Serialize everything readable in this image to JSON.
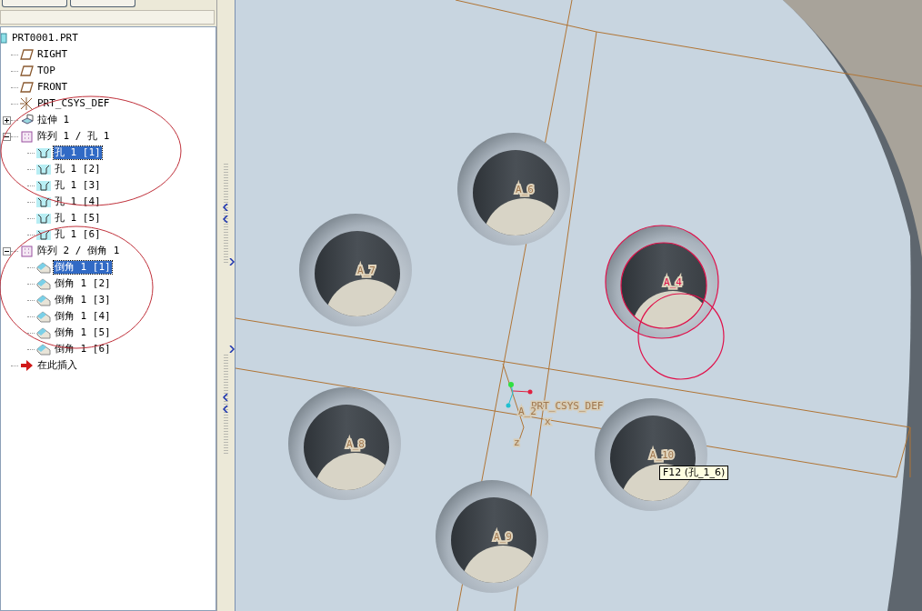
{
  "model_tree": {
    "root": {
      "label": "PRT0001.PRT",
      "kind": "part",
      "children": [
        {
          "label": "RIGHT",
          "kind": "plane",
          "selected": false
        },
        {
          "label": "TOP",
          "kind": "plane",
          "selected": false
        },
        {
          "label": "FRONT",
          "kind": "plane",
          "selected": false
        },
        {
          "label": "PRT_CSYS_DEF",
          "kind": "csys",
          "selected": false
        },
        {
          "label": "拉伸 1",
          "kind": "extrude",
          "selected": false,
          "expanded": false
        },
        {
          "label": "阵列 1 / 孔 1",
          "kind": "pattern",
          "selected": false,
          "expanded": true,
          "children": [
            {
              "label": "孔 1 [1]",
              "kind": "hole",
              "selected": true
            },
            {
              "label": "孔 1 [2]",
              "kind": "hole",
              "selected": false
            },
            {
              "label": "孔 1 [3]",
              "kind": "hole",
              "selected": false
            },
            {
              "label": "孔 1 [4]",
              "kind": "hole",
              "selected": false
            },
            {
              "label": "孔 1 [5]",
              "kind": "hole",
              "selected": false
            },
            {
              "label": "孔 1 [6]",
              "kind": "hole",
              "selected": false
            }
          ]
        },
        {
          "label": "阵列 2 / 倒角 1",
          "kind": "pattern",
          "selected": false,
          "expanded": true,
          "children": [
            {
              "label": "倒角 1 [1]",
              "kind": "chamfer",
              "selected": true
            },
            {
              "label": "倒角 1 [2]",
              "kind": "chamfer",
              "selected": false
            },
            {
              "label": "倒角 1 [3]",
              "kind": "chamfer",
              "selected": false
            },
            {
              "label": "倒角 1 [4]",
              "kind": "chamfer",
              "selected": false
            },
            {
              "label": "倒角 1 [5]",
              "kind": "chamfer",
              "selected": false
            },
            {
              "label": "倒角 1 [6]",
              "kind": "chamfer",
              "selected": false
            }
          ]
        },
        {
          "label": "在此插入",
          "kind": "insert",
          "selected": false
        }
      ]
    }
  },
  "viewport": {
    "holes": [
      {
        "label": "A_6",
        "highlighted": false
      },
      {
        "label": "A_7",
        "highlighted": false
      },
      {
        "label": "A_4",
        "highlighted": true
      },
      {
        "label": "A_8",
        "highlighted": false
      },
      {
        "label": "A_9",
        "highlighted": false
      },
      {
        "label": "A_10",
        "highlighted": false
      }
    ],
    "csys": {
      "label": "PRT_CSYS_DEF",
      "axis_label": "A_2",
      "x_label": "x",
      "z_label": "z"
    },
    "tooltip": "F12 (孔_1_6)"
  }
}
